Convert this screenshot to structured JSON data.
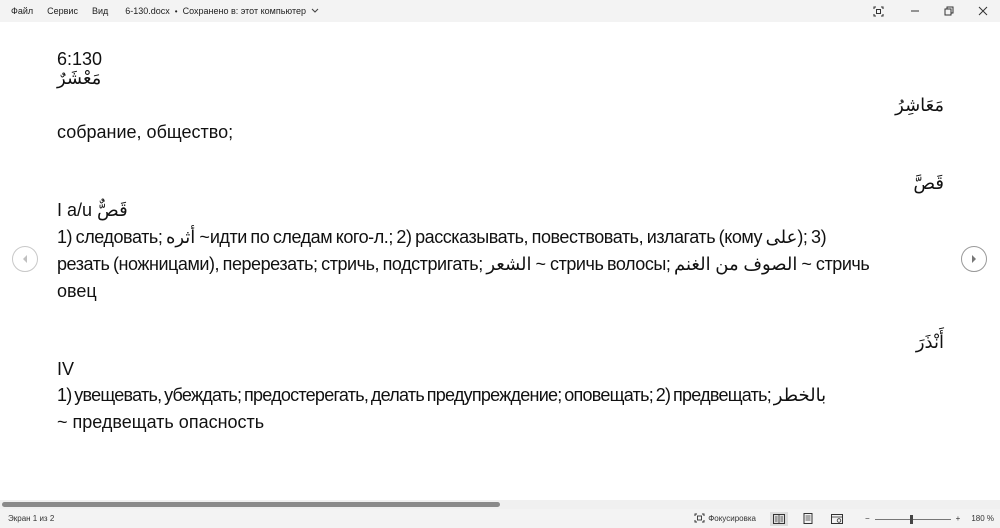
{
  "menu": {
    "file": "Файл",
    "service": "Сервис",
    "view": "Вид"
  },
  "document": {
    "filename": "6-130.docx",
    "separator": "•",
    "save_status": "Сохранено в: этот компьютер"
  },
  "window": {
    "focus_icon": "focus-mode-icon",
    "minimize": "minimize-icon",
    "restore": "restore-icon",
    "close": "close-icon"
  },
  "content": {
    "ref": "6:130",
    "entry1": {
      "arabic_left": "مَعْشَرٌ",
      "arabic_right": "مَعَاشِرُ",
      "meaning": "собрание, общество;"
    },
    "entry2": {
      "arabic_right": "قَصَّ",
      "stem": "I a/u ",
      "stem_arabic": "قَصٌّ",
      "line1_a": "1) следовать; ",
      "line1_ar": "أثره",
      "line1_b": " ~идти по следам кого-л.;  2) рассказывать, повествовать, излагать (кому ",
      "line1_ar2": "على",
      "line1_c": ");  3)",
      "line2_a": "резать (ножницами), перерезать; стричь, подстригать;  ",
      "line2_ar": "الشعر",
      "line2_b": " ~ стричь волосы; ",
      "line2_ar2": "الصوف من الغنم",
      "line2_c": " ~ стричь",
      "line3": "овец"
    },
    "entry3": {
      "arabic_right": "أَنْذَرَ",
      "stem": "IV",
      "line1": "1) увещевать, убеждать; предостерегать, делать предупреждение; оповещать; 2) предвещать; ",
      "line1_ar": "بالخطر",
      "line2": "~ предвещать опасность"
    }
  },
  "status": {
    "page_info": "Экран 1 из 2",
    "focus_label": "Фокусировка",
    "zoom_minus": "−",
    "zoom_plus": "+",
    "zoom_level": "180 %"
  },
  "colors": {
    "chrome_bg": "#f3f3f3",
    "page_bg": "#ffffff",
    "text": "#111111"
  }
}
